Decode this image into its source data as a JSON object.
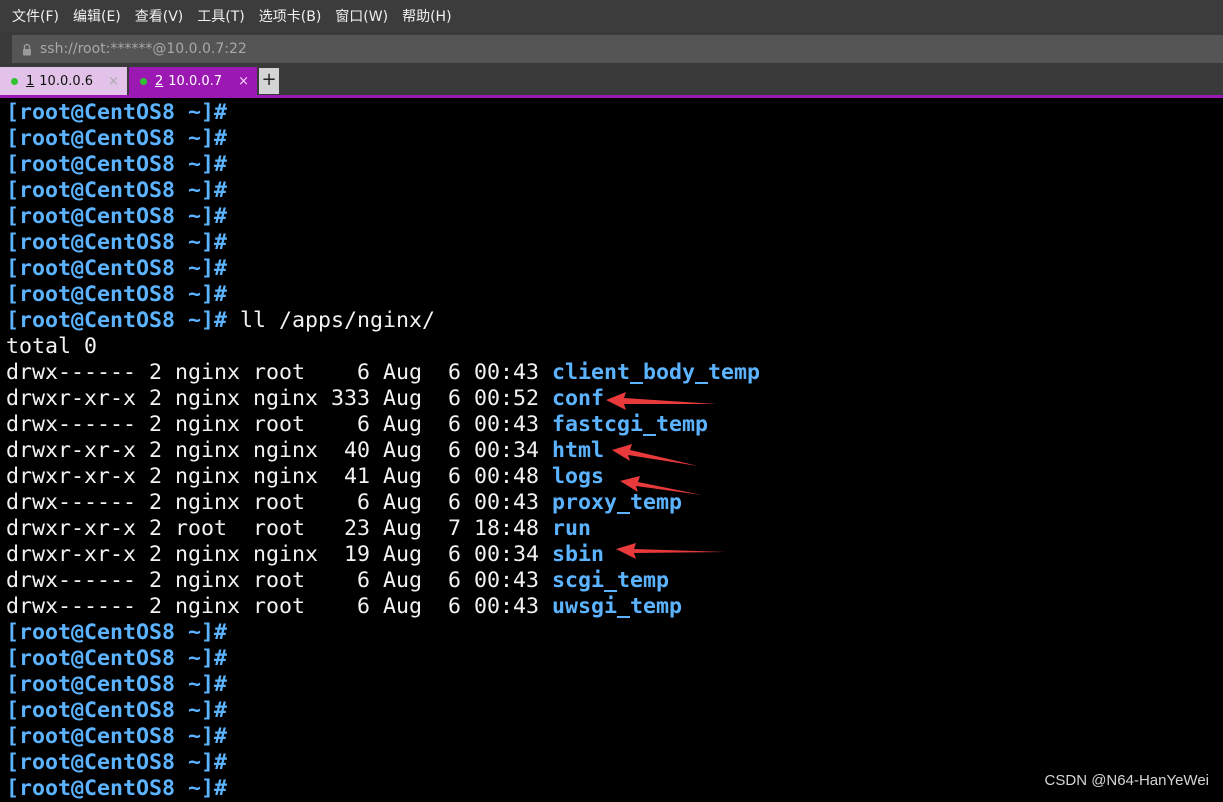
{
  "menu": [
    "文件(F)",
    "编辑(E)",
    "查看(V)",
    "工具(T)",
    "选项卡(B)",
    "窗口(W)",
    "帮助(H)"
  ],
  "address": "ssh://root:******@10.0.0.7:22",
  "tabs": [
    {
      "num": "1",
      "label": "10.0.0.6",
      "close": "×"
    },
    {
      "num": "2",
      "label": "10.0.0.7",
      "close": "×"
    }
  ],
  "new_tab": "+",
  "prompt": "[root@CentOS8 ~]#",
  "command": " ll /apps/nginx/",
  "total": "total 0",
  "listing": [
    {
      "meta": "drwx------ 2 nginx root    6 Aug  6 00:43 ",
      "name": "client_body_temp"
    },
    {
      "meta": "drwxr-xr-x 2 nginx nginx 333 Aug  6 00:52 ",
      "name": "conf"
    },
    {
      "meta": "drwx------ 2 nginx root    6 Aug  6 00:43 ",
      "name": "fastcgi_temp"
    },
    {
      "meta": "drwxr-xr-x 2 nginx nginx  40 Aug  6 00:34 ",
      "name": "html"
    },
    {
      "meta": "drwxr-xr-x 2 nginx nginx  41 Aug  6 00:48 ",
      "name": "logs"
    },
    {
      "meta": "drwx------ 2 nginx root    6 Aug  6 00:43 ",
      "name": "proxy_temp"
    },
    {
      "meta": "drwxr-xr-x 2 root  root   23 Aug  7 18:48 ",
      "name": "run"
    },
    {
      "meta": "drwxr-xr-x 2 nginx nginx  19 Aug  6 00:34 ",
      "name": "sbin"
    },
    {
      "meta": "drwx------ 2 nginx root    6 Aug  6 00:43 ",
      "name": "scgi_temp"
    },
    {
      "meta": "drwx------ 2 nginx root    6 Aug  6 00:43 ",
      "name": "uwsgi_temp"
    }
  ],
  "watermark": "CSDN @N64-HanYeWei",
  "colors": {
    "prompt": "#5cb3ff",
    "active_tab": "#9c18b2",
    "annotation_arrow": "#e8393b"
  }
}
